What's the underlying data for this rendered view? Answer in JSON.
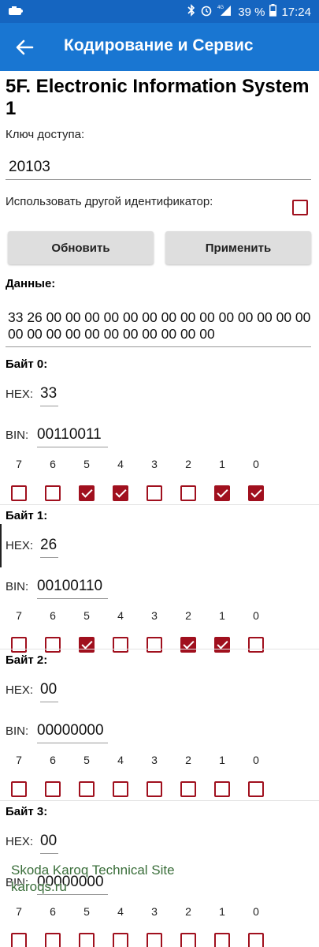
{
  "status_bar": {
    "battery_percent": "39 %",
    "time": "17:24",
    "network": "4G",
    "icons": [
      "app-notification-icon",
      "bluetooth-icon",
      "alarm-icon",
      "signal-icon",
      "battery-icon"
    ]
  },
  "appbar": {
    "title": "Кодирование и Сервис",
    "back_icon": "arrow-left-icon"
  },
  "module": {
    "title": "5F. Electronic Information System 1"
  },
  "access_key": {
    "label": "Ключ доступа:",
    "value": "20103"
  },
  "alt_identifier": {
    "label": "Использовать другой идентификатор:",
    "checked": false
  },
  "buttons": {
    "refresh": "Обновить",
    "apply": "Применить"
  },
  "data": {
    "label": "Данные:",
    "value": "33 26 00 00 00 00 00 00 00 00 00 00 00 00 00 00 00 00 00 00 00 00 00 00 00 00 00"
  },
  "hex_label": "HEX:",
  "bin_label": "BIN:",
  "bit_labels": [
    "7",
    "6",
    "5",
    "4",
    "3",
    "2",
    "1",
    "0"
  ],
  "bytes": [
    {
      "title": "Байт 0:",
      "hex": "33",
      "bin": "00110011",
      "bits": [
        false,
        false,
        true,
        true,
        false,
        false,
        true,
        true
      ]
    },
    {
      "title": "Байт 1:",
      "hex": "26",
      "bin": "00100110",
      "bits": [
        false,
        false,
        true,
        false,
        false,
        true,
        true,
        false
      ]
    },
    {
      "title": "Байт 2:",
      "hex": "00",
      "bin": "00000000",
      "bits": [
        false,
        false,
        false,
        false,
        false,
        false,
        false,
        false
      ]
    },
    {
      "title": "Байт 3:",
      "hex": "00",
      "bin": "00000000",
      "bits": [
        false,
        false,
        false,
        false,
        false,
        false,
        false,
        false
      ]
    }
  ],
  "watermark": {
    "line1": "Skoda Karoq Technical Site",
    "line2": "karoqs.ru"
  },
  "colors": {
    "statusbar": "#1565c0",
    "appbar": "#1976d2",
    "checkbox": "#a0101e"
  }
}
